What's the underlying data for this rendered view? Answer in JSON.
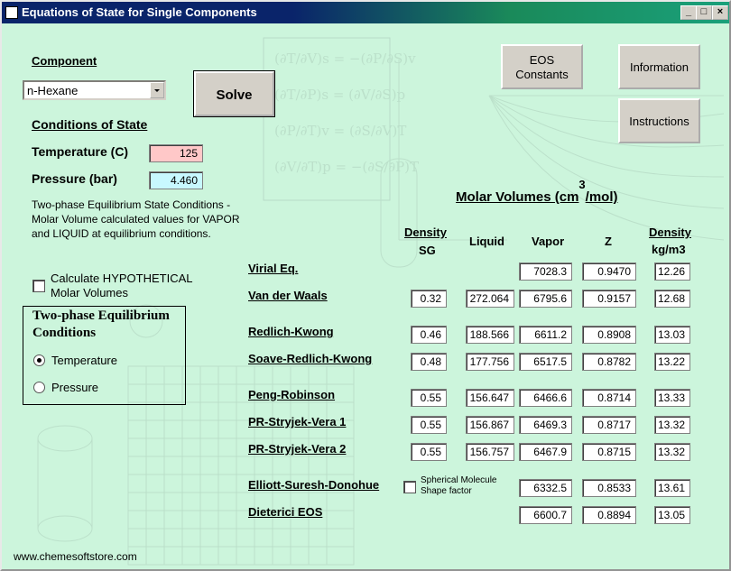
{
  "window": {
    "title": "Equations of State for Single Components"
  },
  "component": {
    "heading": "Component",
    "selected": "n-Hexane"
  },
  "solve_label": "Solve",
  "buttons": {
    "eos": "EOS\nConstants",
    "eos_line1": "EOS",
    "eos_line2": "Constants",
    "information": "Information",
    "instructions": "Instructions"
  },
  "conditions": {
    "heading": "Conditions of State",
    "temperature_label": "Temperature  (C)",
    "temperature_value": "125",
    "pressure_label": "Pressure  (bar)",
    "pressure_value": "4.460"
  },
  "note": {
    "line1": "Two-phase Equilibrium State Conditions -",
    "line2": "Molar Volume calculated values for VAPOR",
    "line3": "and LIQUID at equilibrium conditions."
  },
  "hypothetical": {
    "line1": "Calculate HYPOTHETICAL",
    "line2": "Molar Volumes",
    "checked": false
  },
  "equilibrium_group": {
    "title_line1": "Two-phase Equilibrium",
    "title_line2": "Conditions",
    "options": [
      "Temperature",
      "Pressure"
    ],
    "selected": "Temperature"
  },
  "table": {
    "title_main": "Molar Volumes (cm",
    "title_sup": "3",
    "title_tail": "/mol)",
    "headers": {
      "density_sg_1": "Density",
      "density_sg_2": "SG",
      "liquid": "Liquid",
      "vapor": "Vapor",
      "z": "Z",
      "density_kg_1": "Density",
      "density_kg_2": "kg/m3"
    },
    "rows": [
      {
        "name": "Virial Eq.",
        "sg": "",
        "liquid": "",
        "vapor": "7028.3",
        "z": "0.9470",
        "density": "12.26"
      },
      {
        "name": "Van der Waals",
        "sg": "0.32",
        "liquid": "272.064",
        "vapor": "6795.6",
        "z": "0.9157",
        "density": "12.68"
      },
      {
        "name": "Redlich-Kwong",
        "sg": "0.46",
        "liquid": "188.566",
        "vapor": "6611.2",
        "z": "0.8908",
        "density": "13.03"
      },
      {
        "name": "Soave-Redlich-Kwong",
        "sg": "0.48",
        "liquid": "177.756",
        "vapor": "6517.5",
        "z": "0.8782",
        "density": "13.22"
      },
      {
        "name": "Peng-Robinson",
        "sg": "0.55",
        "liquid": "156.647",
        "vapor": "6466.6",
        "z": "0.8714",
        "density": "13.33"
      },
      {
        "name": "PR-Stryjek-Vera 1",
        "sg": "0.55",
        "liquid": "156.867",
        "vapor": "6469.3",
        "z": "0.8717",
        "density": "13.32"
      },
      {
        "name": "PR-Stryjek-Vera 2",
        "sg": "0.55",
        "liquid": "156.757",
        "vapor": "6467.9",
        "z": "0.8715",
        "density": "13.32"
      },
      {
        "name": "Elliott-Suresh-Donohue",
        "sg": "",
        "liquid": "",
        "vapor": "6332.5",
        "z": "0.8533",
        "density": "13.61"
      },
      {
        "name": "Dieterici EOS",
        "sg": "",
        "liquid": "",
        "vapor": "6600.7",
        "z": "0.8894",
        "density": "13.05"
      }
    ]
  },
  "spherical": {
    "line1": "Spherical Molecule",
    "line2": "Shape factor",
    "checked": false
  },
  "footer": "www.chemesoftstore.com"
}
